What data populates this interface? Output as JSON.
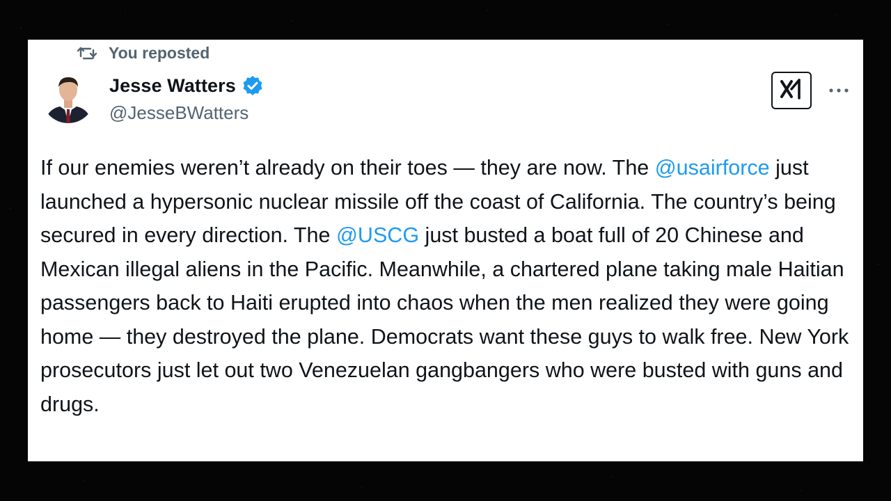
{
  "repost": {
    "label": "You reposted"
  },
  "author": {
    "name": "Jesse Watters",
    "handle": "@JesseBWatters",
    "verified": true,
    "verified_icon": "verified-badge-icon",
    "verified_color": "#1d9bf0"
  },
  "actions": {
    "grok_icon": "grok-icon",
    "more_icon": "more-icon"
  },
  "tweet": {
    "segments": [
      {
        "type": "text",
        "text": "If our enemies weren’t already on their toes — they are now. The "
      },
      {
        "type": "mention",
        "text": "@usairforce"
      },
      {
        "type": "text",
        "text": " just launched a hypersonic nuclear missile off the coast of California. The country’s being secured in every direction. The "
      },
      {
        "type": "mention",
        "text": "@USCG"
      },
      {
        "type": "text",
        "text": " just busted a boat full of 20 Chinese and Mexican illegal aliens in the Pacific. Meanwhile, a chartered plane taking male Haitian passengers back to Haiti erupted into chaos when the men realized they were going home — they destroyed the plane. Democrats want these guys to walk free. New York prosecutors just let out two Venezuelan gangbangers who were busted with guns and drugs."
      }
    ]
  },
  "colors": {
    "text": "#0f1419",
    "secondary": "#536471",
    "link": "#1d9bf0",
    "card": "#ffffff",
    "background": "#050505"
  }
}
